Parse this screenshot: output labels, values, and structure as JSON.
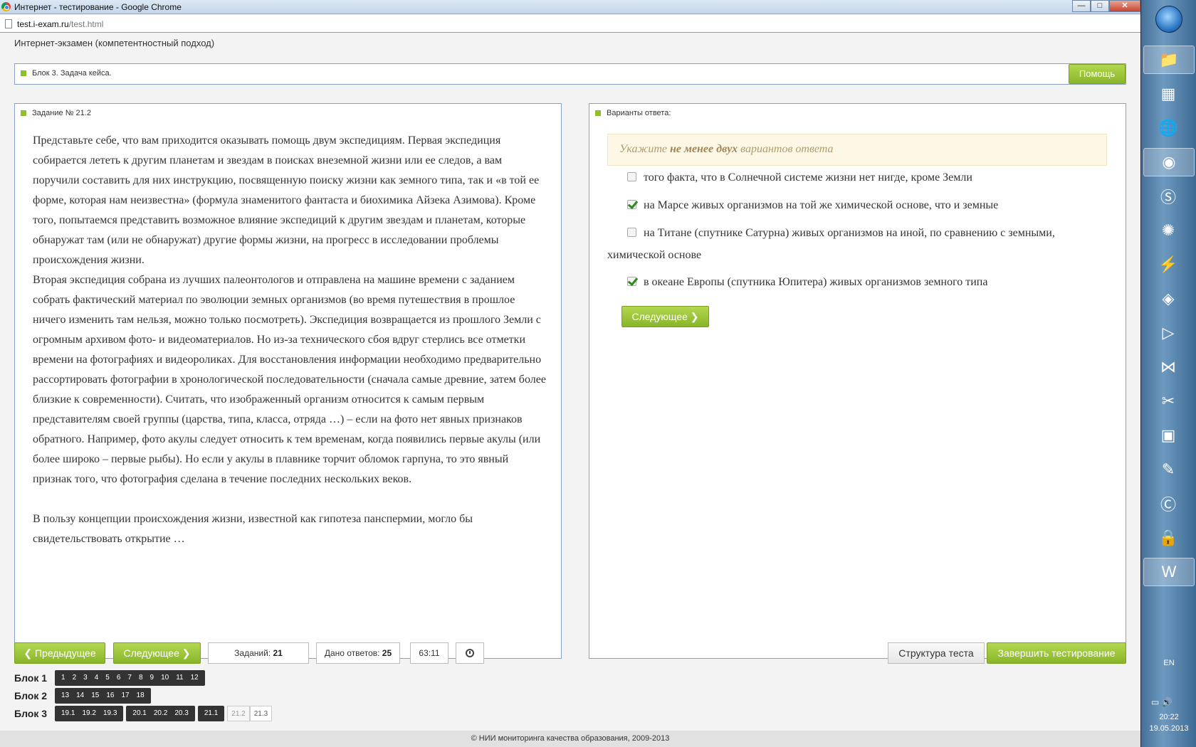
{
  "window": {
    "title": "Интернет - тестирование - Google Chrome",
    "minimize": "—",
    "maximize": "□",
    "close": "✕"
  },
  "browser": {
    "url_host": "test.i-exam.ru",
    "url_path": "/test.html"
  },
  "app": {
    "header": "Интернет-экзамен (компетентностный подход)",
    "block_title": "Блок 3. Задача кейса.",
    "help_label": "Помощь"
  },
  "task": {
    "heading": "Задание № 21.2",
    "paragraphs": [
      "Представьте себе, что вам приходится оказывать помощь двум экспедициям. Первая экспедиция собирается лететь к другим планетам и звездам в поисках внеземной жизни или ее следов, а вам поручили составить для них инструкцию, посвященную поиску жизни как земного типа, так и «в той ее форме, которая нам неизвестна» (формула знаменитого фантаста и биохимика Айзека Азимова). Кроме того, попытаемся представить возможное влияние экспедиций к другим звездам и планетам, которые обнаружат там (или не обнаружат) другие формы жизни, на прогресс в исследовании проблемы происхождения жизни.",
      "Вторая экспедиция собрана из лучших палеонтологов и отправлена на машине времени с заданием собрать фактический материал по эволюции земных организмов (во время путешествия в прошлое ничего изменить там нельзя, можно только посмотреть). Экспедиция возвращается из прошлого Земли с огромным архивом фото- и видеоматериалов. Но из-за технического сбоя вдруг стерлись все отметки времени на фотографиях и видеороликах. Для восстановления информации необходимо предварительно рассортировать фотографии в хронологической последовательности (сначала самые древние, затем более близкие к современности). Считать, что изображенный организм относится к самым первым представителям своей группы (царства, типа, класса, отряда …) – если на фото нет явных признаков обратного. Например, фото акулы следует относить к тем временам, когда появились первые акулы (или более широко – первые рыбы). Но если у акулы в плавнике торчит обломок гарпуна, то это явный признак того, что фотография сделана в течение последних нескольких веков."
    ],
    "question": "В пользу концепции происхождения жизни, известной как гипотеза панспермии, могло бы свидетельствовать открытие …"
  },
  "answers": {
    "heading": "Варианты ответа:",
    "instruction_pre": "Укажите ",
    "instruction_bold": "не менее двух",
    "instruction_post": " вариантов ответа",
    "options": [
      {
        "text": "того факта, что в Солнечной системе жизни нет нигде, кроме Земли",
        "checked": false
      },
      {
        "text": "на Марсе живых организмов на той же химической основе, что и земные",
        "checked": true
      },
      {
        "text": "на Титане (спутнике Сатурна) живых организмов на иной, по сравнению с земными, химической основе",
        "checked": false
      },
      {
        "text": "в океане Европы (спутника Юпитера) живых организмов земного типа",
        "checked": true
      }
    ],
    "next_label": "Следующее"
  },
  "nav": {
    "prev_label": "Предыдущее",
    "next_label": "Следующее",
    "tasks_label": "Заданий:",
    "tasks_value": "21",
    "answered_label": "Дано ответов:",
    "answered_value": "25",
    "timer": "63:11",
    "structure_label": "Структура теста",
    "finish_label": "Завершить тестирование"
  },
  "blocks": [
    {
      "label": "Блок 1",
      "groups": [
        [
          "1",
          "2",
          "3",
          "4",
          "5",
          "6",
          "7",
          "8",
          "9",
          "10",
          "11",
          "12"
        ]
      ]
    },
    {
      "label": "Блок 2",
      "groups": [
        [
          "13",
          "14",
          "15",
          "16",
          "17",
          "18"
        ]
      ]
    },
    {
      "label": "Блок 3",
      "groups": [
        [
          "19.1",
          "19.2",
          "19.3"
        ],
        [
          "20.1",
          "20.2",
          "20.3"
        ],
        [
          "21.1"
        ]
      ],
      "pending": [
        "21.2",
        "21.3"
      ]
    }
  ],
  "footer": "© НИИ мониторинга качества образования, 2009-2013",
  "taskbar": {
    "lang": "EN",
    "time": "20:22",
    "date": "19.05.2013"
  },
  "colors": {
    "accent_green": "#8dbe2d",
    "border_blue": "#8aa0c8"
  }
}
